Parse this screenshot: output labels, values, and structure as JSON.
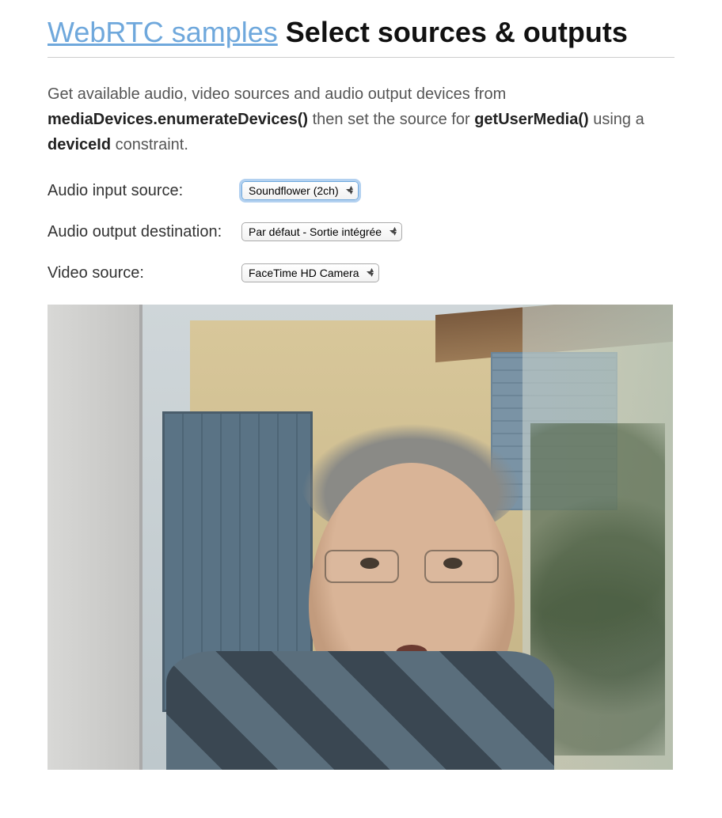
{
  "heading": {
    "link": "WebRTC samples",
    "title": "Select sources & outputs"
  },
  "intro": {
    "pre": "Get available audio, video sources and audio output devices from ",
    "code1": "mediaDevices.enumerateDevices()",
    "mid": " then set the source for ",
    "code2": "getUserMedia()",
    "mid2": " using a ",
    "code3": "deviceId",
    "post": " constraint."
  },
  "rows": {
    "audioInput": {
      "label": "Audio input source:",
      "value": "Soundflower (2ch)"
    },
    "audioOutput": {
      "label": "Audio output destination:",
      "value": "Par défaut - Sortie intégrée"
    },
    "videoSource": {
      "label": "Video source:",
      "value": "FaceTime HD Camera"
    }
  }
}
